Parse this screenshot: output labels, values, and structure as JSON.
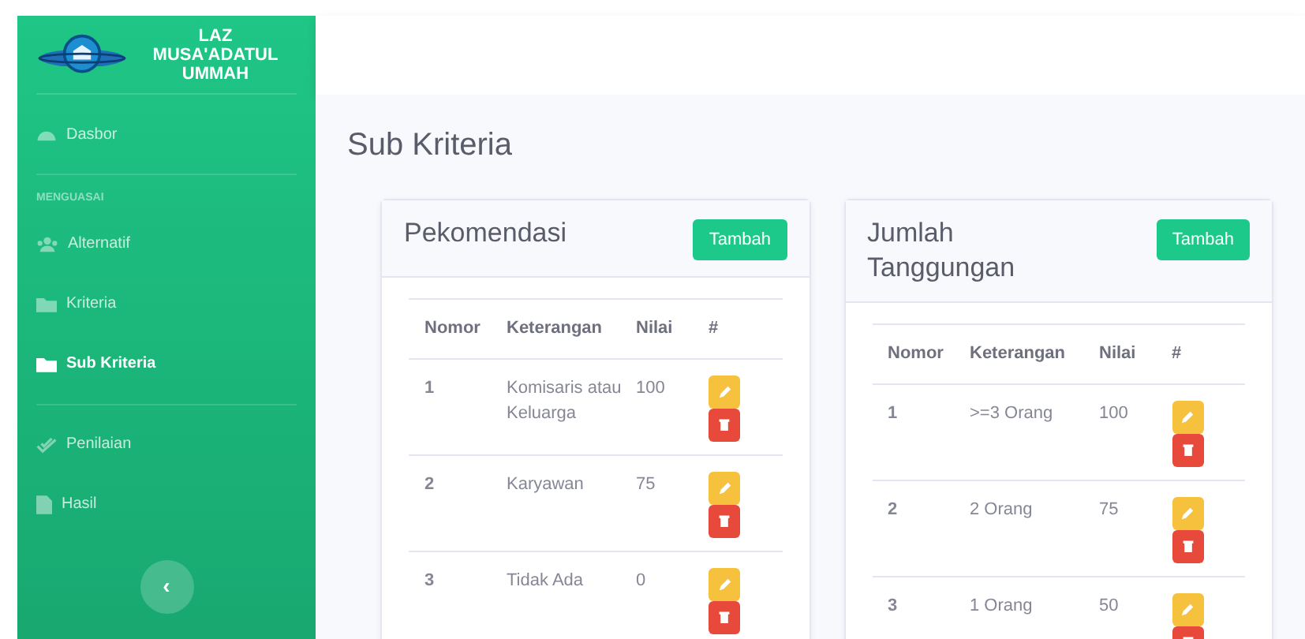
{
  "sidebar": {
    "brand": [
      "LAZ",
      "MUSA'ADATUL",
      "UMMAH"
    ],
    "groups": [
      {
        "items": [
          {
            "label": "Dasbor",
            "selected": false
          }
        ]
      },
      {
        "heading": "MENGUASAI",
        "items": [
          {
            "label": "Alternatif",
            "selected": false
          },
          {
            "label": "Kriteria",
            "selected": false
          },
          {
            "label": "Sub Kriteria",
            "selected": true
          }
        ]
      },
      {
        "items": [
          {
            "label": "Penilaian",
            "selected": false
          },
          {
            "label": "Hasil",
            "selected": false
          }
        ]
      }
    ],
    "toggle": "‹"
  },
  "page_title": "Sub Kriteria",
  "cards": [
    {
      "title": "Pekomendasi",
      "button": "Tambah",
      "columns": [
        "Nomor",
        "Keterangan",
        "Nilai",
        "#"
      ],
      "rows": [
        {
          "no": "1",
          "keterangan": "Komisaris atau Keluarga",
          "nilai": "100"
        },
        {
          "no": "2",
          "keterangan": "Karyawan",
          "nilai": "75"
        },
        {
          "no": "3",
          "keterangan": "Tidak Ada",
          "nilai": "0"
        }
      ]
    },
    {
      "title": "Jumlah Tanggungan",
      "button": "Tambah",
      "columns": [
        "Nomor",
        "Keterangan",
        "Nilai",
        "#"
      ],
      "rows": [
        {
          "no": "1",
          "keterangan": ">=3 Orang",
          "nilai": "100"
        },
        {
          "no": "2",
          "keterangan": "2 Orang",
          "nilai": "75"
        },
        {
          "no": "3",
          "keterangan": "1 Orang",
          "nilai": "50"
        }
      ]
    }
  ]
}
